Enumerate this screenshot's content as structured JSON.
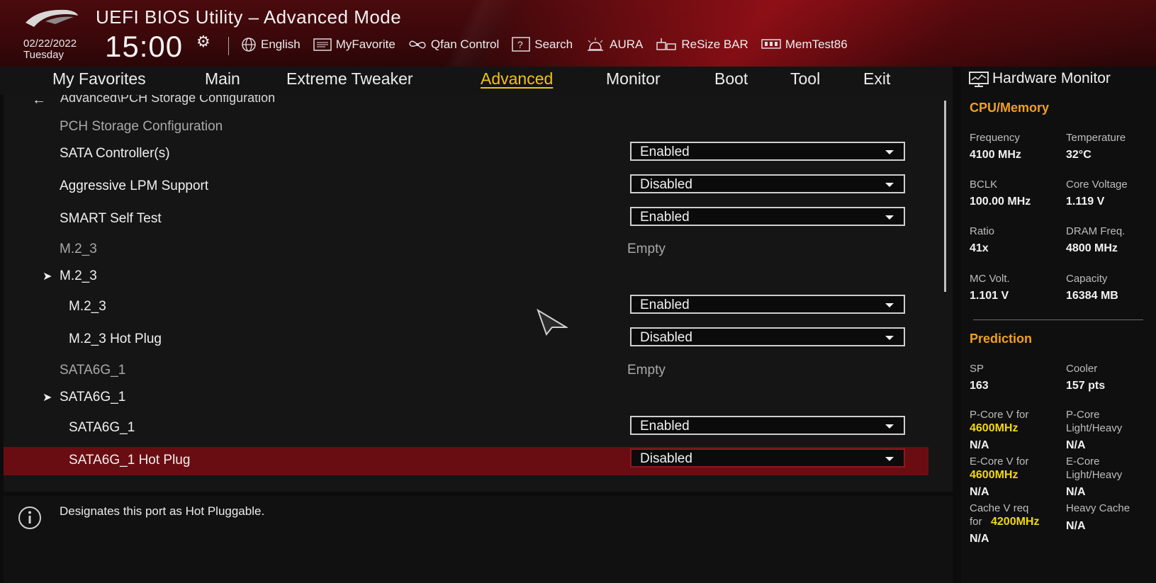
{
  "header": {
    "title": "UEFI BIOS Utility – Advanced Mode",
    "date": "02/22/2022",
    "day": "Tuesday",
    "time": "15:00",
    "toolbar": [
      {
        "label": "English",
        "icon": "globe-icon"
      },
      {
        "label": "MyFavorite",
        "icon": "favorite-list-icon"
      },
      {
        "label": "Qfan Control",
        "icon": "fan-icon"
      },
      {
        "label": "Search",
        "icon": "search-help-icon"
      },
      {
        "label": "AURA",
        "icon": "aura-light-icon"
      },
      {
        "label": "ReSize BAR",
        "icon": "resize-bar-icon"
      },
      {
        "label": "MemTest86",
        "icon": "memory-icon"
      }
    ]
  },
  "tabs": {
    "items": [
      "My Favorites",
      "Main",
      "Extreme Tweaker",
      "Advanced",
      "Monitor",
      "Boot",
      "Tool",
      "Exit"
    ],
    "active": "Advanced"
  },
  "main": {
    "breadcrumb": "Advanced\\PCH Storage Configuration",
    "rows": [
      {
        "label": "PCH Storage Configuration"
      },
      {
        "label": "SATA Controller(s)",
        "value": "Enabled"
      },
      {
        "label": "Aggressive LPM Support",
        "value": "Disabled"
      },
      {
        "label": "SMART Self Test",
        "value": "Enabled"
      },
      {
        "label": "M.2_3",
        "status": "Empty"
      },
      {
        "label": "M.2_3"
      },
      {
        "label": "M.2_3",
        "value": "Enabled"
      },
      {
        "label": "M.2_3 Hot Plug",
        "value": "Disabled"
      },
      {
        "label": "SATA6G_1",
        "status": "Empty"
      },
      {
        "label": "SATA6G_1"
      },
      {
        "label": "SATA6G_1",
        "value": "Enabled"
      },
      {
        "label": "SATA6G_1 Hot Plug",
        "value": "Disabled"
      }
    ]
  },
  "help": {
    "text": "Designates this port as Hot Pluggable."
  },
  "hw_monitor": {
    "title": "Hardware Monitor",
    "cpu_memory": {
      "title": "CPU/Memory",
      "frequency_label": "Frequency",
      "frequency": "4100 MHz",
      "temperature_label": "Temperature",
      "temperature": "32°C",
      "bclk_label": "BCLK",
      "bclk": "100.00 MHz",
      "core_voltage_label": "Core Voltage",
      "core_voltage": "1.119 V",
      "ratio_label": "Ratio",
      "ratio": "41x",
      "dram_freq_label": "DRAM Freq.",
      "dram_freq": "4800 MHz",
      "mc_volt_label": "MC Volt.",
      "mc_volt": "1.101 V",
      "capacity_label": "Capacity",
      "capacity": "16384 MB"
    },
    "prediction": {
      "title": "Prediction",
      "sp_label": "SP",
      "sp": "163",
      "cooler_label": "Cooler",
      "cooler": "157 pts",
      "pcore_v_label": "P-Core V for",
      "pcore_v_freq": "4600MHz",
      "pcore_v": "N/A",
      "pcore_lh_label_1": "P-Core",
      "pcore_lh_label_2": "Light/Heavy",
      "pcore_lh": "N/A",
      "ecore_v_label": "E-Core V for",
      "ecore_v_freq": "4600MHz",
      "ecore_v": "N/A",
      "ecore_lh_label_1": "E-Core",
      "ecore_lh_label_2": "Light/Heavy",
      "ecore_lh": "N/A",
      "cache_v_label_1": "Cache V req",
      "cache_v_label_2": "for",
      "cache_v_freq": "4200MHz",
      "cache_v": "N/A",
      "heavy_cache_label": "Heavy Cache",
      "heavy_cache": "N/A"
    }
  },
  "colors": {
    "accent_tab": "#f1c40f",
    "section_title": "#f0a020",
    "prediction_freq": "#f1d80f",
    "selected_row": "#6a0d12"
  }
}
